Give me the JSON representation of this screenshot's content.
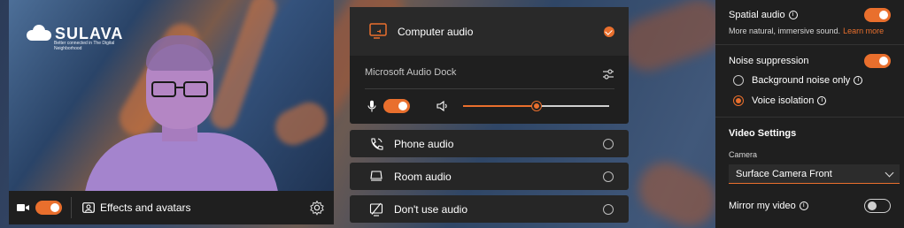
{
  "video": {
    "brand_name": "SULAVA",
    "brand_tagline": "Better connected in The Digital Neighborhood",
    "effects_label": "Effects and avatars",
    "camera_on": true
  },
  "audio": {
    "computer_audio_label": "Computer audio",
    "computer_audio_selected": true,
    "device_name": "Microsoft Audio Dock",
    "mic_on": true,
    "speaker_volume_percent": 50,
    "phone_audio_label": "Phone audio",
    "room_audio_label": "Room audio",
    "no_audio_label": "Don't use audio"
  },
  "settings": {
    "spatial_audio_label": "Spatial audio",
    "spatial_audio_on": true,
    "spatial_audio_desc": "More natural, immersive sound.",
    "learn_more_label": "Learn more",
    "noise_suppression_label": "Noise suppression",
    "noise_suppression_on": true,
    "noise_options": [
      {
        "label": "Background noise only",
        "selected": false
      },
      {
        "label": "Voice isolation",
        "selected": true
      }
    ],
    "video_settings_heading": "Video Settings",
    "camera_label": "Camera",
    "camera_value": "Surface Camera Front",
    "mirror_label": "Mirror my video",
    "mirror_on": false
  },
  "colors": {
    "accent": "#e96f2d",
    "panel_bg": "#1f1f1f"
  }
}
